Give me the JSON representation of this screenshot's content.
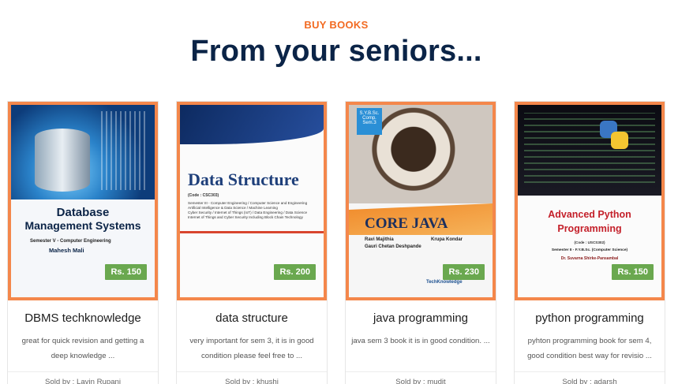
{
  "section": {
    "eyebrow": "BUY BOOKS",
    "heading": "From your seniors..."
  },
  "books": [
    {
      "title": "DBMS techknowledge",
      "description": "great for quick revision and getting a deep knowledge ...",
      "seller": "Sold by : Lavin Rupani",
      "price": "Rs. 150",
      "cover": {
        "title_line1": "Database",
        "title_line2": "Management Systems",
        "subtitle": "Semester V - Computer Engineering",
        "author": "Mahesh Mali"
      }
    },
    {
      "title": "data structure",
      "description": "very important for sem 3, it is in good condition please feel free to ...",
      "seller": "Sold by : khushi",
      "price": "Rs. 200",
      "cover": {
        "title": "Data Structure",
        "code": "(Code : CSC303)"
      }
    },
    {
      "title": "java programming",
      "description": "java sem 3 book it is in good condition. ...",
      "seller": "Sold by : mudit",
      "price": "Rs. 230",
      "cover": {
        "badge": "S.Y.B.Sc. Comp. Sem.3",
        "title": "CORE JAVA",
        "author1": "Ravi Majithia",
        "author2": "Krupa Kondar",
        "author3": "Gauri Chetan Deshpande",
        "publisher": "TechKnowledge"
      }
    },
    {
      "title": "python programming",
      "description": "pyhton programming book for sem 4, good condition best way for revisio ...",
      "seller": "Sold by : adarsh",
      "price": "Rs. 150",
      "cover": {
        "title_line1": "Advanced Python",
        "title_line2": "Programming",
        "code": "(Code : USCS302)",
        "subtitle": "Semester II - F.Y.B.Sc. (Computer Science)",
        "author": "Dr. Suvarna Shirke-Pansambal"
      }
    }
  ],
  "colors": {
    "accent": "#f26a21",
    "heading": "#0b2447",
    "price_badge": "#6aa84f",
    "card_border": "#f4874b"
  }
}
